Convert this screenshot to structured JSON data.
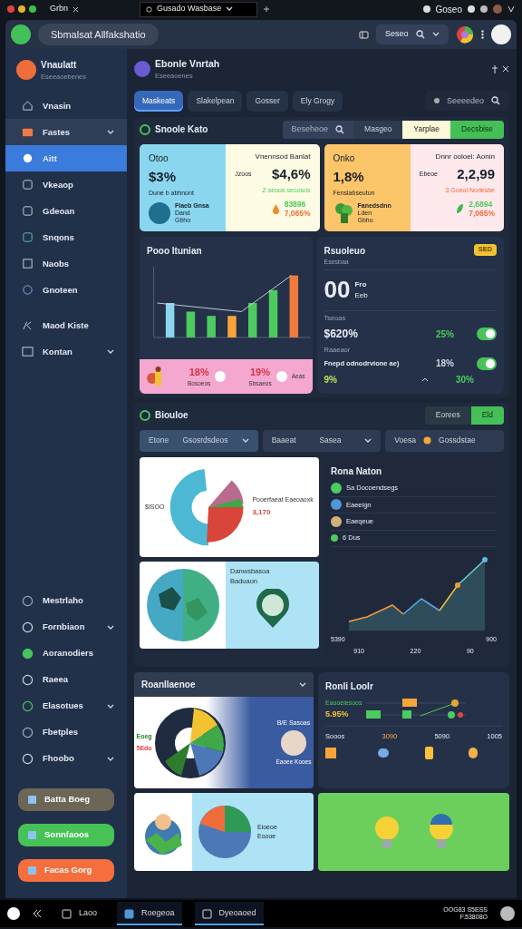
{
  "browser": {
    "tabs": [
      {
        "label": "Grbn",
        "selected": false
      },
      {
        "label": "Gusado Wasbase",
        "selected": true
      }
    ],
    "account": "Goseo"
  },
  "app_header": {
    "title": "Sbmalsat Allfakshatio",
    "search": {
      "value": "Seseo"
    }
  },
  "sidebar": {
    "profile": {
      "name": "Vnaulatt",
      "subtitle": "Eseeaoebenes"
    },
    "items": [
      {
        "label": "Vnasin",
        "kind": "link",
        "expanded": false,
        "selected": false
      },
      {
        "label": "Fastes",
        "kind": "group",
        "expanded": true,
        "selected": false
      },
      {
        "label": "Aitt",
        "kind": "link",
        "expanded": false,
        "selected": true
      },
      {
        "label": "Vkeaop",
        "kind": "link",
        "expanded": false,
        "selected": false
      },
      {
        "label": "Gdeoan",
        "kind": "link",
        "expanded": false,
        "selected": false
      },
      {
        "label": "Snqons",
        "kind": "link",
        "expanded": false,
        "selected": false
      },
      {
        "label": "Naobs",
        "kind": "link",
        "expanded": false,
        "selected": false
      },
      {
        "label": "Gnoteen",
        "kind": "link",
        "expanded": false,
        "selected": false
      },
      {
        "label": "Maod Kiste",
        "kind": "link",
        "expanded": false,
        "selected": false
      },
      {
        "label": "Kontan",
        "kind": "group",
        "expanded": false,
        "selected": false
      }
    ],
    "lower_items": [
      {
        "label": "Mestrlaho",
        "kind": "link"
      },
      {
        "label": "Fornbiaon",
        "kind": "group"
      },
      {
        "label": "Aoranodiers",
        "kind": "link"
      },
      {
        "label": "Raeea",
        "kind": "link"
      },
      {
        "label": "Elasotues",
        "kind": "group"
      },
      {
        "label": "Fbetples",
        "kind": "link"
      },
      {
        "label": "Fhoobo",
        "kind": "group"
      }
    ],
    "buttons": [
      {
        "label": "Batta Boeg",
        "kind": "neutral"
      },
      {
        "label": "Sonnfaoos",
        "kind": "success"
      },
      {
        "label": "Facas Gorg",
        "kind": "warning"
      }
    ]
  },
  "page": {
    "title": "Ebonle Vnrtah",
    "subtitle": "Eseeaoenes",
    "tabs": [
      {
        "label": "Maskeats",
        "selected": true
      },
      {
        "label": "Slakelpean",
        "selected": false
      },
      {
        "label": "Gosser",
        "selected": false
      },
      {
        "label": "Ely Grogy",
        "selected": false
      }
    ],
    "search": {
      "placeholder": "Seeeedeo"
    }
  },
  "overview": {
    "title": "Snoole Kato",
    "search": {
      "placeholder": "Beseheoe"
    },
    "segments": [
      {
        "label": "Masgeo",
        "selected": false
      },
      {
        "label": "Yarplae",
        "selected": true
      }
    ],
    "action": "Decsbise",
    "stat_cards": [
      {
        "kind": "cool",
        "label": "Otoo",
        "value": "$3%",
        "note": "Dune b abhnont",
        "person": [
          "Flaeb Gnsa",
          "Dand",
          "Gbho"
        ],
        "title": "Vnennsod Banlat",
        "sub_label": "Jzoos",
        "sub_value": "$4,6%",
        "sub_note": "Z seoos seoosos",
        "up": "83896",
        "down": "7,065%"
      },
      {
        "kind": "warm",
        "label": "Onko",
        "value": "1,8%",
        "note": "Fenslabseuton",
        "person": [
          "Fanedsdnn",
          "Lden",
          "Gbho"
        ],
        "title": "Dnnr ooloel: Aonin",
        "sub_label": "Ebeoe",
        "sub_value": "2,2,99",
        "sub_note": "3 Goeol Nodesbe",
        "up": "2,6894",
        "down": "7,065%"
      }
    ],
    "bar_card": {
      "title": "Pooo Itunian",
      "strip": [
        {
          "value": "18%",
          "label": "Bosoeos"
        },
        {
          "value": "19%",
          "label": "Sbsaeos"
        }
      ],
      "strip_end": "Aeas"
    },
    "summary_card": {
      "title": "Rsuoleuo",
      "subtitle": "Esesbaa",
      "badge": "SED",
      "big": "00",
      "big_label": "Fro",
      "big_sub": "Eeb",
      "rows": [
        {
          "caption": "Tseoas",
          "value": "$620%",
          "pct": "25%",
          "on": true
        },
        {
          "caption": "Raaeaor",
          "value": "Fnepd odnodrvione ae)",
          "pct": "18%",
          "on": true
        }
      ],
      "footer": [
        "9%",
        "30%"
      ]
    }
  },
  "breakdown": {
    "title": "Biouloe",
    "toggle": [
      {
        "label": "Eorees",
        "selected": false
      },
      {
        "label": "Eld",
        "selected": true
      }
    ],
    "dropdowns": [
      {
        "label": "Etone",
        "value": "Gsosrdsdeos",
        "kind": "select"
      },
      {
        "label": "Baaeat",
        "value": "Sasea",
        "kind": "select"
      },
      {
        "label": "Voesa",
        "value": "Gossdstae",
        "kind": "icon"
      }
    ],
    "pie_labels": [
      "$ISOO",
      "3,170",
      "Pooerfaeat Eaeoaoxk"
    ],
    "map_text": "Danwsbasoa Baduaon",
    "line_card": {
      "title": "Rona Naton",
      "legend": [
        "Sa Docoendsegs",
        "Eaeeign",
        "Eaeqeue",
        "6 Dus"
      ],
      "y_labels": [
        "5390",
        "900"
      ],
      "x_labels": [
        "910",
        "220",
        "90"
      ]
    }
  },
  "bottom": {
    "donut_card": {
      "title": "Roanllaenoe",
      "labels": [
        "Eoeg",
        "5Edo"
      ],
      "side_label": "B/E Sasoas",
      "person_caption": "Eaoee Kooes"
    },
    "timeline_card": {
      "title": "Ronli Loolr",
      "label": "Eaooeiesoos",
      "value": "5.95%",
      "cols": [
        "Sooos",
        "3090",
        "5090",
        "1005"
      ]
    },
    "illustration_text": [
      "Eioeoe",
      "Eoooe"
    ]
  },
  "taskbar": {
    "items": [
      {
        "label": "Laoo",
        "selected": false
      },
      {
        "label": "Roegeoa",
        "selected": true
      },
      {
        "label": "Dyeoaoed",
        "selected": true
      }
    ],
    "clock": [
      "OOG83 S5ESS",
      "F.53808O"
    ]
  }
}
